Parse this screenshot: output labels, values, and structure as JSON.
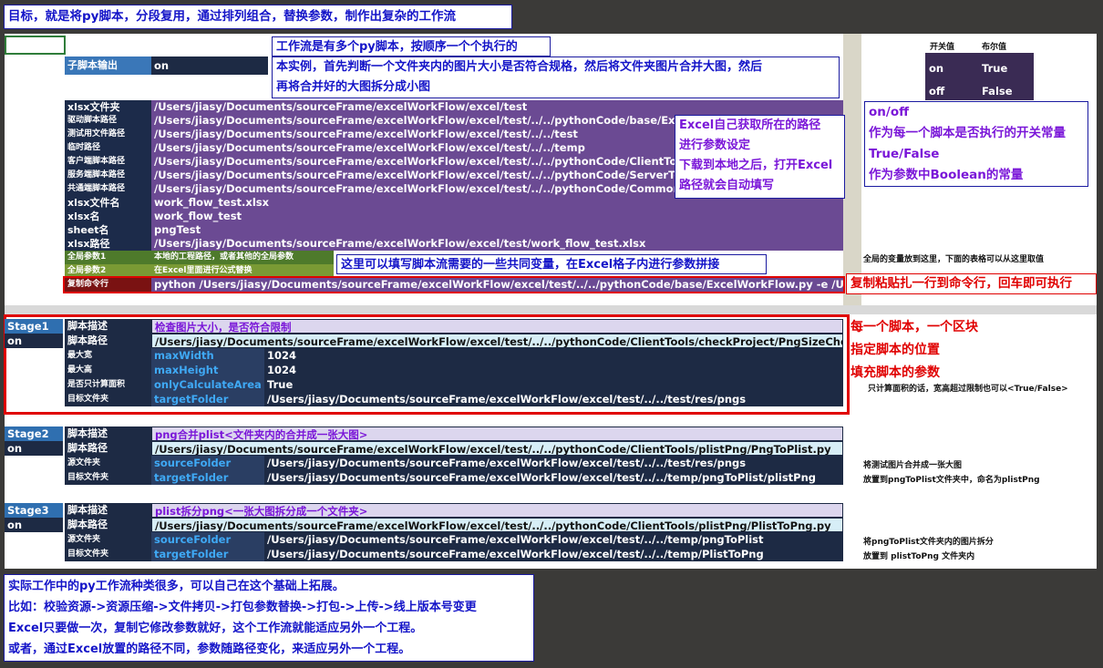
{
  "header_note": "目标，就是将py脚本，分段复用，通过排列组合，替换参数，制作出复杂的工作流",
  "flow_note": {
    "line1": "工作流是有多个py脚本，按顺序一个个执行的",
    "line2": "本实例，首先判断一个文件夹内的图片大小是否符合规格，然后将文件夹图片合并大图，然后",
    "line3": "再将合并好的大图拆分成小图"
  },
  "sub_output": {
    "label": "子脚本输出",
    "value": "on"
  },
  "switch_table": {
    "header_switch": "开关值",
    "header_bool": "布尔值",
    "rows": [
      {
        "switch": "on",
        "bool": "True"
      },
      {
        "switch": "off",
        "bool": "False"
      }
    ]
  },
  "onoff_note": {
    "l1": "on/off",
    "l2": "作为每一个脚本是否执行的开关常量",
    "l3": "True/False",
    "l4": "作为参数中Boolean的常量"
  },
  "excel_note": {
    "l1": "Excel自己获取所在的路径",
    "l2": "进行参数设定",
    "l3": "下载到本地之后，打开Excel",
    "l4": "路径就会自动填写"
  },
  "global_rows": [
    {
      "label": "xlsx文件夹",
      "value": "/Users/jiasy/Documents/sourceFrame/excelWorkFlow/excel/test"
    },
    {
      "label": "驱动脚本路径",
      "value": "/Users/jiasy/Documents/sourceFrame/excelWorkFlow/excel/test/../../pythonCode/base/ExcelWorkFlow.py"
    },
    {
      "label": "测试用文件路径",
      "value": "/Users/jiasy/Documents/sourceFrame/excelWorkFlow/excel/test/../../test"
    },
    {
      "label": "临时路径",
      "value": "/Users/jiasy/Documents/sourceFrame/excelWorkFlow/excel/test/../../temp"
    },
    {
      "label": "客户端脚本路径",
      "value": "/Users/jiasy/Documents/sourceFrame/excelWorkFlow/excel/test/../../pythonCode/ClientTools"
    },
    {
      "label": "服务端脚本路径",
      "value": "/Users/jiasy/Documents/sourceFrame/excelWorkFlow/excel/test/../../pythonCode/ServerTools"
    },
    {
      "label": "共通端脚本路径",
      "value": "/Users/jiasy/Documents/sourceFrame/excelWorkFlow/excel/test/../../pythonCode/CommonTools"
    },
    {
      "label": "xlsx文件名",
      "value": "work_flow_test.xlsx"
    },
    {
      "label": "xlsx名",
      "value": "work_flow_test"
    },
    {
      "label": "sheet名",
      "value": "pngTest"
    },
    {
      "label": "xlsx路径",
      "value": "/Users/jiasy/Documents/sourceFrame/excelWorkFlow/excel/test/work_flow_test.xlsx"
    }
  ],
  "global_params": [
    {
      "label": "全局参数1",
      "value": "本地的工程路径，或者其他的全局参数"
    },
    {
      "label": "全局参数2",
      "value": "在Excel里面进行公式替换"
    }
  ],
  "global_side_note": "全局的变量放到这里，下面的表格可以从这里取值",
  "params_note": "这里可以填写脚本流需要的一些共同变量，在Excel格子内进行参数拼接",
  "command_row": {
    "label": "复制命令行",
    "value": "python /Users/jiasy/Documents/sourceFrame/excelWorkFlow/excel/test/../../pythonCode/base/ExcelWorkFlow.py -e /Users/jiasy/"
  },
  "command_note": "复制粘贴扎一行到命令行，回车即可执行",
  "stages": [
    {
      "name": "Stage1",
      "switch": "on",
      "desc_label": "脚本描述",
      "desc": "检查图片大小，是否符合限制",
      "path_label": "脚本路径",
      "path": "/Users/jiasy/Documents/sourceFrame/excelWorkFlow/excel/test/../../pythonCode/ClientTools/checkProject/PngSizeCheck.py",
      "params": [
        {
          "label": "最大宽",
          "key": "maxWidth",
          "value": "1024"
        },
        {
          "label": "最大高",
          "key": "maxHeight",
          "value": "1024"
        },
        {
          "label": "是否只计算面积",
          "key": "onlyCalculateArea",
          "value": "True"
        },
        {
          "label": "目标文件夹",
          "key": "targetFolder",
          "value": "/Users/jiasy/Documents/sourceFrame/excelWorkFlow/excel/test/../../test/res/pngs"
        }
      ],
      "side_notes": [
        "只计算面积的话，宽高超过限制也可以<True/False>"
      ]
    },
    {
      "name": "Stage2",
      "switch": "on",
      "desc_label": "脚本描述",
      "desc": "png合并plist<文件夹内的合并成一张大图>",
      "path_label": "脚本路径",
      "path": "/Users/jiasy/Documents/sourceFrame/excelWorkFlow/excel/test/../../pythonCode/ClientTools/plistPng/PngToPlist.py",
      "params": [
        {
          "label": "源文件夹",
          "key": "sourceFolder",
          "value": "/Users/jiasy/Documents/sourceFrame/excelWorkFlow/excel/test/../../test/res/pngs"
        },
        {
          "label": "目标文件夹",
          "key": "targetFolder",
          "value": "/Users/jiasy/Documents/sourceFrame/excelWorkFlow/excel/test/../../temp/pngToPlist/plistPng"
        }
      ],
      "side_notes": [
        "将测试图片合并成一张大图",
        "放置到pngToPlist文件夹中，命名为plistPng"
      ]
    },
    {
      "name": "Stage3",
      "switch": "on",
      "desc_label": "脚本描述",
      "desc": "plist拆分png<一张大图拆分成一个文件夹>",
      "path_label": "脚本路径",
      "path": "/Users/jiasy/Documents/sourceFrame/excelWorkFlow/excel/test/../../pythonCode/ClientTools/plistPng/PlistToPng.py",
      "params": [
        {
          "label": "源文件夹",
          "key": "sourceFolder",
          "value": "/Users/jiasy/Documents/sourceFrame/excelWorkFlow/excel/test/../../temp/pngToPlist"
        },
        {
          "label": "目标文件夹",
          "key": "targetFolder",
          "value": "/Users/jiasy/Documents/sourceFrame/excelWorkFlow/excel/test/../../temp/PlistToPng"
        }
      ],
      "side_notes": [
        "将pngToPlist文件夹内的图片拆分",
        "放置到 plistToPng 文件夹内"
      ]
    }
  ],
  "block_note": {
    "l1": "每一个脚本，一个区块",
    "l2": "指定脚本的位置",
    "l3": "填充脚本的参数"
  },
  "bottom_note": {
    "l1": "实际工作中的py工作流种类很多，可以自己在这个基础上拓展。",
    "l2": "比如：校验资源->资源压缩->文件拷贝->打包参数替换->打包->上传->线上版本号变更",
    "l3": "Excel只要做一次，复制它修改参数就好，这个工作流就能适应另外一个工程。",
    "l4": "或者，通过Excel放置的路径不同，参数随路径变化，来适应另外一个工程。"
  },
  "colors": {
    "background": "#3b3a38",
    "note_text": "#1414c8",
    "purple_text": "#7a16d8",
    "highlight_red": "#e00000"
  }
}
